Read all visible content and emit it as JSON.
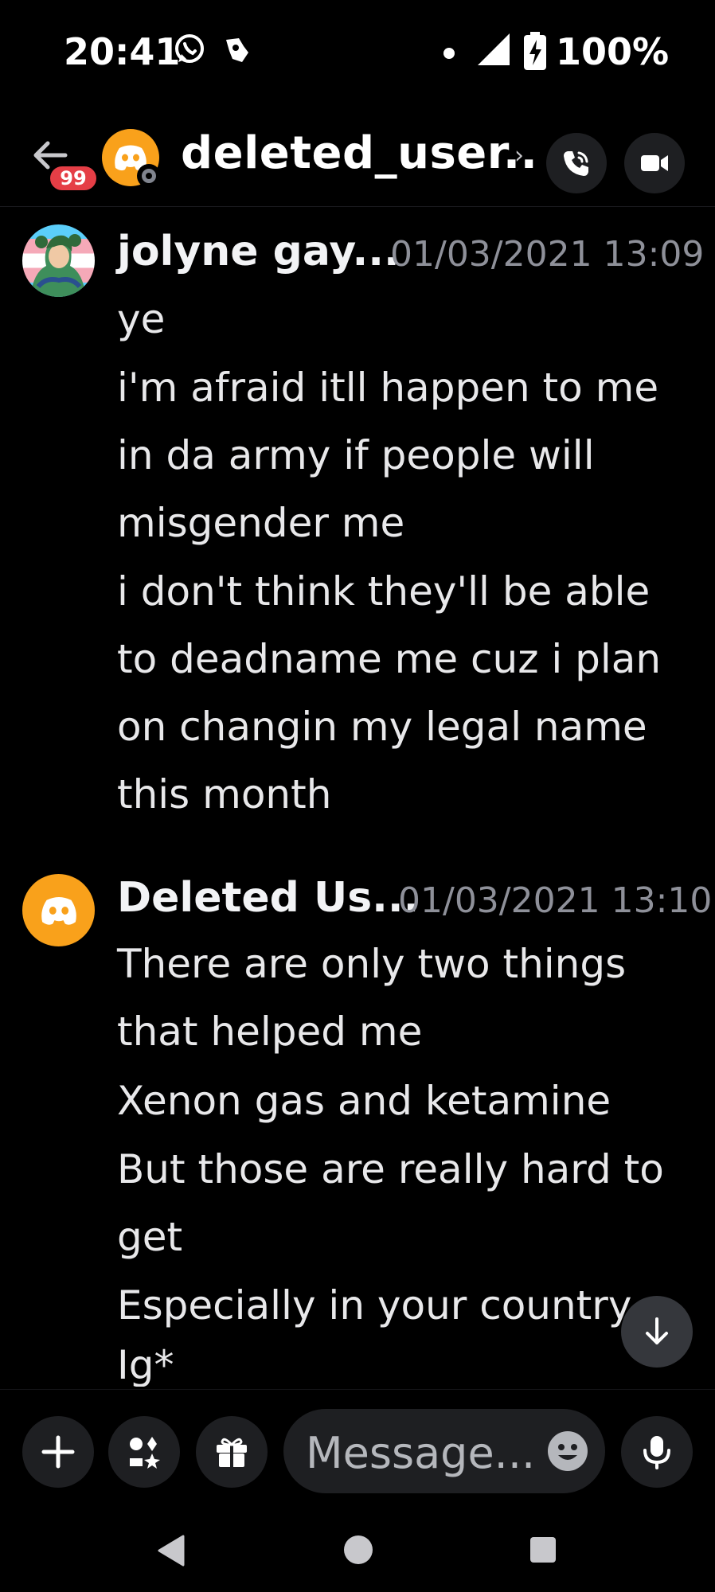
{
  "status_bar": {
    "time": "20:41",
    "battery": "100%",
    "icons": [
      "whatsapp-icon",
      "app-notification-icon",
      "signal-icon",
      "battery-charging-icon"
    ]
  },
  "header": {
    "unread_badge": "99",
    "title": "deleted_user..",
    "chevron": "›",
    "presence": "offline"
  },
  "messages": [
    {
      "author": "jolyne gay...",
      "timestamp": "01/03/2021 13:09",
      "avatar": "jolyne-avatar",
      "lines": [
        "ye",
        "i'm afraid itll happen to me",
        "in da army if people will",
        "misgender me",
        "i don't think they'll be able",
        "to deadname me cuz i plan",
        "on changin my legal name",
        "this month"
      ]
    },
    {
      "author": "Deleted Us...",
      "timestamp": "01/03/2021 13:10",
      "avatar": "discord-default-avatar",
      "lines": [
        "There are only two things",
        "that helped me",
        "Xenon gas and ketamine",
        "But those are really hard to",
        "get",
        "Especially in your country",
        "Ig*"
      ]
    }
  ],
  "composer": {
    "placeholder": "Message..."
  },
  "colors": {
    "background": "#000000",
    "discord_orange": "#f9a11b",
    "badge_red": "#e53e46",
    "button_bg": "#1e1f22",
    "timestamp": "#8e9099"
  }
}
